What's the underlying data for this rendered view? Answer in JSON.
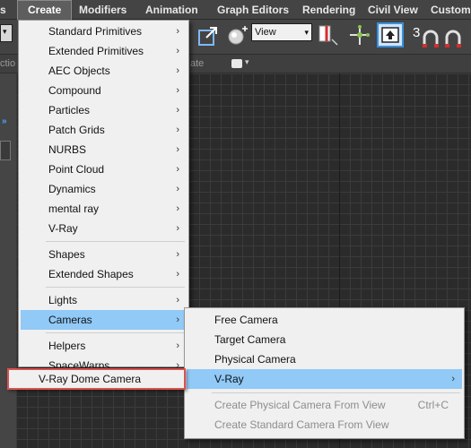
{
  "menubar": {
    "items": [
      "s",
      "Create",
      "Modifiers",
      "Animation",
      "Graph Editors",
      "Rendering",
      "Civil View",
      "Customi"
    ]
  },
  "toolbar": {
    "left_combo_glyph": "▾",
    "view_select": "View",
    "view_select_caret": "▾",
    "snap_digit": "3"
  },
  "strip": {
    "left_text": "ctio",
    "mid_text": "ate"
  },
  "left_panel": {
    "chevron": "»"
  },
  "create_menu": {
    "items": [
      {
        "label": "Standard Primitives",
        "arrow": "›"
      },
      {
        "label": "Extended Primitives",
        "arrow": "›"
      },
      {
        "label": "AEC Objects",
        "arrow": "›"
      },
      {
        "label": "Compound",
        "arrow": "›"
      },
      {
        "label": "Particles",
        "arrow": "›"
      },
      {
        "label": "Patch Grids",
        "arrow": "›"
      },
      {
        "label": "NURBS",
        "arrow": "›"
      },
      {
        "label": "Point Cloud",
        "arrow": "›"
      },
      {
        "label": "Dynamics",
        "arrow": "›"
      },
      {
        "label": "mental ray",
        "arrow": "›"
      },
      {
        "label": "V-Ray",
        "arrow": "›"
      },
      {
        "label": "Shapes",
        "arrow": "›"
      },
      {
        "label": "Extended Shapes",
        "arrow": "›"
      },
      {
        "label": "Lights",
        "arrow": "›"
      },
      {
        "label": "Cameras",
        "arrow": "›"
      },
      {
        "label": "Helpers",
        "arrow": "›"
      },
      {
        "label": "SpaceWarps",
        "arrow": "›"
      }
    ]
  },
  "cameras_menu": {
    "items": [
      {
        "label": "Free Camera"
      },
      {
        "label": "Target Camera"
      },
      {
        "label": "Physical Camera"
      },
      {
        "label": "V-Ray",
        "arrow": "›"
      },
      {
        "label": "Create Physical Camera From View",
        "shortcut": "Ctrl+C"
      },
      {
        "label": "Create Standard Camera From View"
      }
    ]
  },
  "vray_submenu": {
    "items": [
      {
        "label": "V-Ray Dome Camera"
      }
    ]
  },
  "colors": {
    "menu_highlight": "#91c9f7",
    "callout_border": "#d9534f",
    "app_background": "#444444"
  }
}
